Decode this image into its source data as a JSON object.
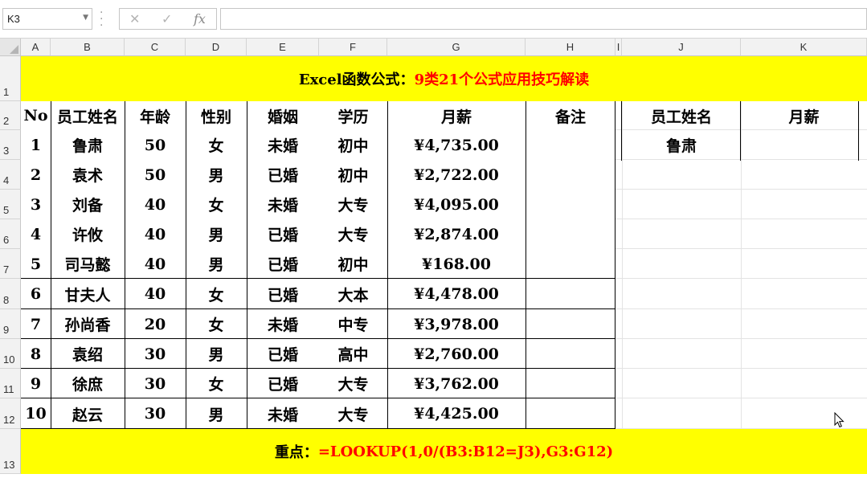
{
  "formula_bar": {
    "name_box": "K3",
    "cancel_glyph": "✕",
    "enter_glyph": "✓",
    "fx_label": "fx",
    "formula": ""
  },
  "columns": [
    "A",
    "B",
    "C",
    "D",
    "E",
    "F",
    "G",
    "H",
    "I",
    "J",
    "K"
  ],
  "rows": [
    "1",
    "2",
    "3",
    "4",
    "5",
    "6",
    "7",
    "8",
    "9",
    "10",
    "11",
    "12",
    "13"
  ],
  "title": {
    "prefix": "Excel函数公式：",
    "main": "9类21个公式应用技巧解读",
    "prefix_color": "#000000",
    "main_color": "#ff0000",
    "background": "#ffff00"
  },
  "table": {
    "headers": [
      "No",
      "员工姓名",
      "年龄",
      "性别",
      "婚姻",
      "学历",
      "月薪",
      "备注"
    ],
    "records": [
      [
        "1",
        "鲁肃",
        "50",
        "女",
        "未婚",
        "初中",
        "¥4,735.00",
        ""
      ],
      [
        "2",
        "袁术",
        "50",
        "男",
        "已婚",
        "初中",
        "¥2,722.00",
        ""
      ],
      [
        "3",
        "刘备",
        "40",
        "女",
        "未婚",
        "大专",
        "¥4,095.00",
        ""
      ],
      [
        "4",
        "许攸",
        "40",
        "男",
        "已婚",
        "大专",
        "¥2,874.00",
        ""
      ],
      [
        "5",
        "司马懿",
        "40",
        "男",
        "已婚",
        "初中",
        "¥168.00",
        ""
      ],
      [
        "6",
        "甘夫人",
        "40",
        "女",
        "已婚",
        "大本",
        "¥4,478.00",
        ""
      ],
      [
        "7",
        "孙尚香",
        "20",
        "女",
        "未婚",
        "中专",
        "¥3,978.00",
        ""
      ],
      [
        "8",
        "袁绍",
        "30",
        "男",
        "已婚",
        "高中",
        "¥2,760.00",
        ""
      ],
      [
        "9",
        "徐庶",
        "30",
        "女",
        "已婚",
        "大专",
        "¥3,762.00",
        ""
      ],
      [
        "10",
        "赵云",
        "30",
        "男",
        "未婚",
        "大专",
        "¥4,425.00",
        ""
      ]
    ]
  },
  "lookup": {
    "headers": [
      "员工姓名",
      "月薪"
    ],
    "values": [
      "鲁肃",
      ""
    ]
  },
  "footer": {
    "label": "重点：",
    "formula": "=LOOKUP(1,0/(B3:B12=J3),G3:G12)",
    "label_color": "#000000",
    "formula_color": "#ff0000",
    "background": "#ffff00"
  }
}
